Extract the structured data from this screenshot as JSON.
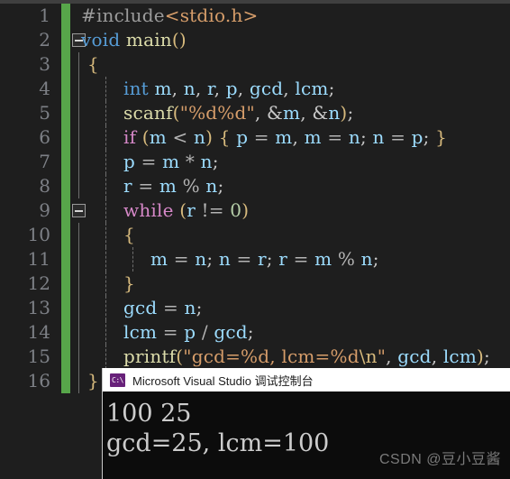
{
  "editor": {
    "theme_bg": "#1e1e1e",
    "gutter_color": "#7d8086",
    "change_bar_color": "#57a64a",
    "lines": [
      {
        "num": "1",
        "text": "#include<stdio.h>"
      },
      {
        "num": "2",
        "text": "void main()"
      },
      {
        "num": "3",
        "text": "{"
      },
      {
        "num": "4",
        "text": "int m, n, r, p, gcd, lcm;"
      },
      {
        "num": "5",
        "text": "scanf(\"%d%d\", &m, &n);"
      },
      {
        "num": "6",
        "text": "if (m < n) { p = m, m = n; n = p; }"
      },
      {
        "num": "7",
        "text": "p = m * n;"
      },
      {
        "num": "8",
        "text": "r = m % n;"
      },
      {
        "num": "9",
        "text": "while (r != 0)"
      },
      {
        "num": "10",
        "text": "{"
      },
      {
        "num": "11",
        "text": "m = n; n = r; r = m % n;"
      },
      {
        "num": "12",
        "text": "}"
      },
      {
        "num": "13",
        "text": "gcd = n;"
      },
      {
        "num": "14",
        "text": "lcm = p / gcd;"
      },
      {
        "num": "15",
        "text": "printf(\"gcd=%d, lcm=%d\\n\", gcd, lcm);"
      },
      {
        "num": "16",
        "text": "}"
      }
    ]
  },
  "console": {
    "title": "Microsoft Visual Studio 调试控制台",
    "icon_name": "console-cmd-icon",
    "output_line_1": "100 25",
    "output_line_2": "gcd=25, lcm=100"
  },
  "watermark": {
    "text": "CSDN @豆小豆酱"
  }
}
